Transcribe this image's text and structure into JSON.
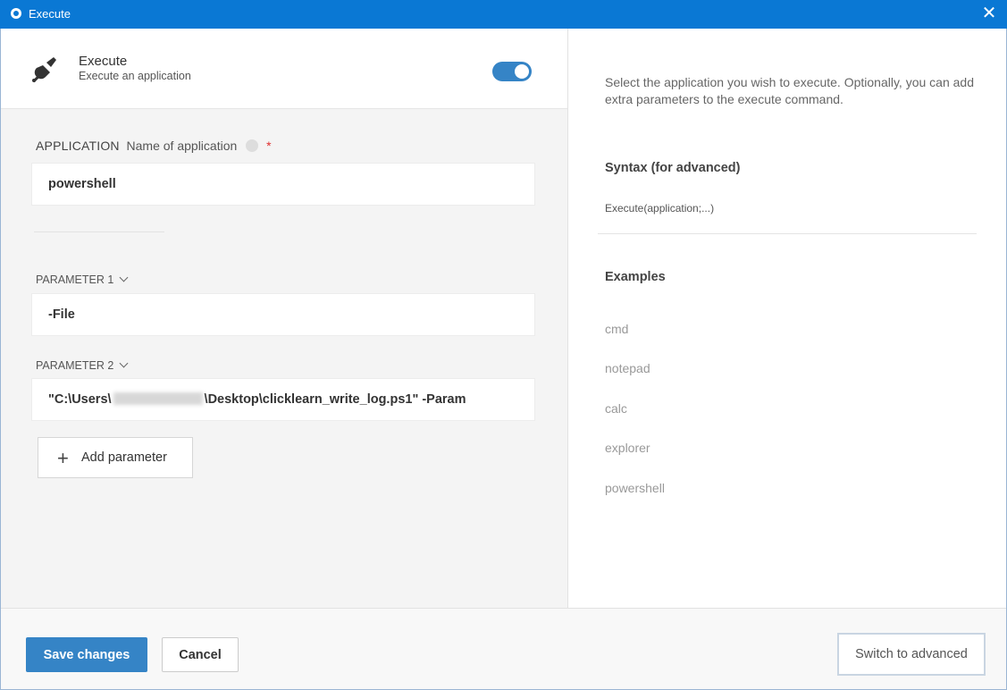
{
  "window": {
    "title": "Execute",
    "close_glyph": "✕"
  },
  "header": {
    "title": "Execute",
    "subtitle": "Execute an application",
    "icon": "plug-icon",
    "toggle_on": true
  },
  "application": {
    "label_main": "APPLICATION",
    "label_desc": "Name of application",
    "required_mark": "*",
    "value": "powershell"
  },
  "parameters": [
    {
      "label": "PARAMETER 1",
      "value": "-File"
    },
    {
      "label": "PARAMETER 2",
      "value_start": "\"C:\\Users\\",
      "value_end": "\\Desktop\\clicklearn_write_log.ps1\" -Param"
    }
  ],
  "add_parameter": {
    "plus": "+",
    "label": "Add parameter"
  },
  "help": {
    "description": "Select the application you wish to execute. Optionally, you can add extra parameters to the execute command.",
    "syntax_heading": "Syntax (for advanced)",
    "syntax": "Execute(application;...)",
    "examples_heading": "Examples",
    "examples": [
      "cmd",
      "notepad",
      "calc",
      "explorer",
      "powershell"
    ]
  },
  "footer": {
    "save": "Save changes",
    "cancel": "Cancel",
    "advanced": "Switch to advanced"
  },
  "colors": {
    "titlebar": "#0a78d4",
    "accent": "#3584c6",
    "required": "#e03030"
  }
}
